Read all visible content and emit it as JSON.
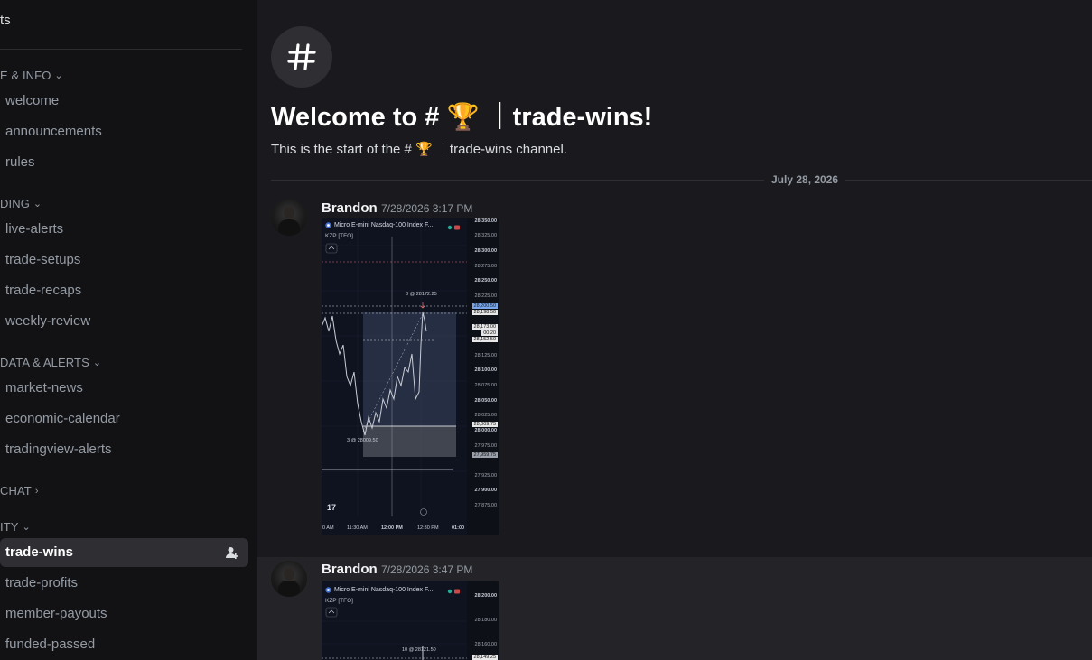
{
  "sidebar": {
    "top_item": "ts",
    "categories": [
      {
        "label": "E & INFO",
        "chevron": "chevron-down-icon"
      },
      {
        "label": "DING",
        "chevron": "chevron-down-icon"
      },
      {
        "label": "DATA & ALERTS",
        "chevron": "chevron-down-icon"
      },
      {
        "label": "CHAT",
        "chevron": "chevron-right-icon"
      },
      {
        "label": "ITY",
        "chevron": "chevron-down-icon"
      }
    ],
    "channels": [
      {
        "label": "welcome"
      },
      {
        "label": "announcements"
      },
      {
        "label": "rules"
      },
      {
        "label": "live-alerts"
      },
      {
        "label": "trade-setups"
      },
      {
        "label": "trade-recaps"
      },
      {
        "label": "weekly-review"
      },
      {
        "label": "market-news"
      },
      {
        "label": "economic-calendar"
      },
      {
        "label": "tradingview-alerts"
      },
      {
        "label": "trade-wins"
      },
      {
        "label": "trade-profits"
      },
      {
        "label": "member-payouts"
      },
      {
        "label": "funded-passed"
      }
    ],
    "active_channel": "trade-wins"
  },
  "main": {
    "welcome_title": "Welcome to # 🏆 ｜trade-wins!",
    "start_text": "This is the start of the # 🏆 ｜trade-wins channel.",
    "date_divider": "July 28, 2026",
    "messages": [
      {
        "author": "Brandon",
        "timestamp": "7/28/2026 3:17 PM",
        "chart": {
          "title": "Micro E-mini Nasdaq-100 Index F...",
          "sub": "KZP [TFO]",
          "ticks": [
            "28,350.00",
            "28,325.00",
            "28,300.00",
            "28,275.00",
            "28,250.00",
            "28,225.00",
            "28,200.00",
            "28,125.00",
            "28,100.00",
            "28,075.00",
            "28,050.00",
            "28,025.00",
            "28,000.00",
            "27,975.00",
            "27,925.00",
            "27,900.00",
            "27,875.00"
          ],
          "tags": [
            "28,200.50",
            "28,198.50",
            "28,173.00",
            "00:20",
            "28,152.50",
            "28,009.75",
            "27,959.75"
          ],
          "annotations": [
            "3 @ 28172.25",
            "3 @ 28009.50"
          ],
          "times": [
            "0 AM",
            "11:30 AM",
            "12:00 PM",
            "12:30 PM",
            "01:00"
          ]
        }
      },
      {
        "author": "Brandon",
        "timestamp": "7/28/2026 3:47 PM",
        "chart": {
          "title": "Micro E-mini Nasdaq-100 Index F...",
          "sub": "KZP [TFO]",
          "ticks": [
            "28,200.00",
            "28,180.00",
            "28,160.00"
          ],
          "tags": [
            "28,149.25"
          ],
          "annotations": [
            "10 @ 28121.50"
          ]
        }
      }
    ]
  }
}
